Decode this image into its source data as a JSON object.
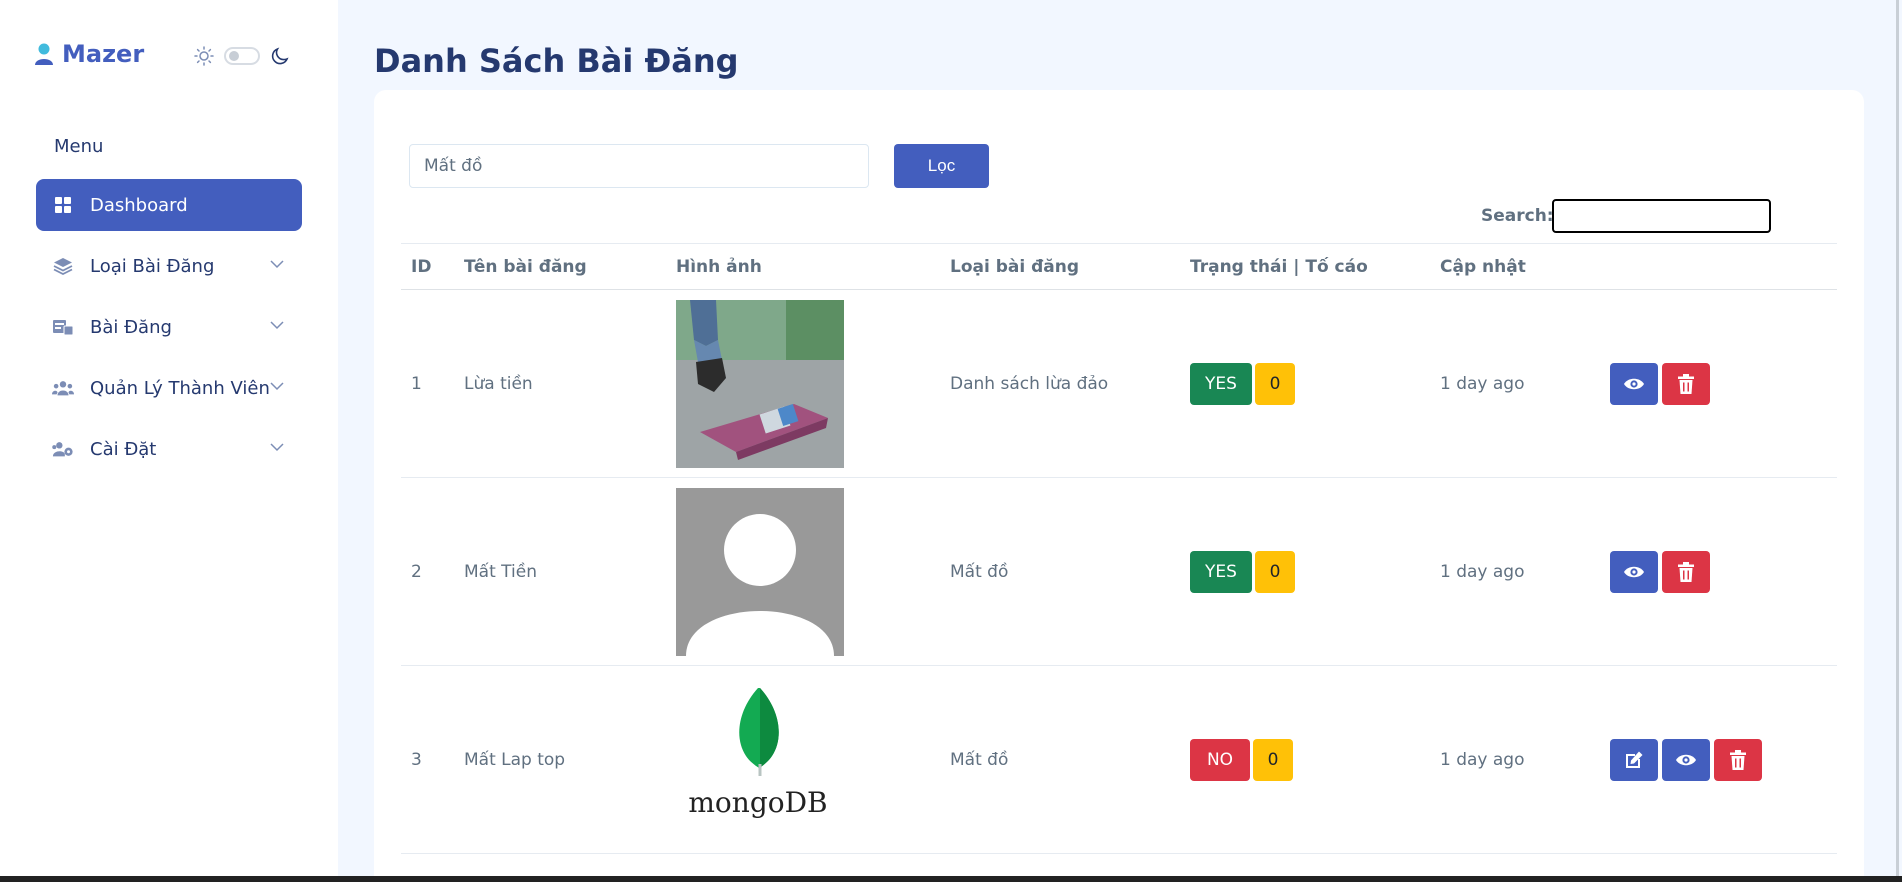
{
  "brand": {
    "name": "Mazer"
  },
  "sidebar": {
    "menu_title": "Menu",
    "items": [
      {
        "label": "Dashboard",
        "icon": "grid-icon",
        "active": true
      },
      {
        "label": "Loại Bài Đăng",
        "icon": "layers-icon"
      },
      {
        "label": "Bài Đăng",
        "icon": "posts-icon"
      },
      {
        "label": "Quản Lý Thành Viên",
        "icon": "users-icon"
      },
      {
        "label": "Cài Đặt",
        "icon": "users-gear-icon"
      }
    ]
  },
  "page": {
    "title": "Danh Sách Bài Đăng"
  },
  "filter": {
    "value": "Mất đồ",
    "button_label": "Lọc"
  },
  "search": {
    "label": "Search:",
    "value": ""
  },
  "table": {
    "headers": [
      "ID",
      "Tên bài đăng",
      "Hình ảnh",
      "Loại bài đăng",
      "Trạng thái | Tố cáo",
      "Cập nhật",
      ""
    ],
    "rows": [
      {
        "id": "1",
        "title": "Lừa tiền",
        "image": "wallet-photo",
        "category": "Danh sách lừa đảo",
        "status": "YES",
        "reports": "0",
        "updated": "1 day ago"
      },
      {
        "id": "2",
        "title": "Mất Tiền",
        "image": "avatar-placeholder",
        "category": "Mất đồ",
        "status": "YES",
        "reports": "0",
        "updated": "1 day ago"
      },
      {
        "id": "3",
        "title": "Mất Lap top",
        "image": "mongodb-logo",
        "image_text": "mongoDB",
        "category": "Mất đồ",
        "status": "NO",
        "reports": "0",
        "updated": "1 day ago"
      }
    ]
  },
  "colors": {
    "primary": "#435ebe",
    "success": "#198754",
    "danger": "#dc3545",
    "warning": "#ffc107",
    "heading": "#25396f",
    "body_bg": "#f2f7ff"
  }
}
